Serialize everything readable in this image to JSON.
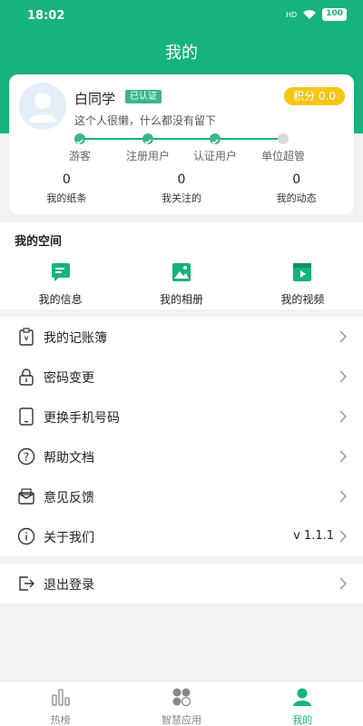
{
  "status_bar": {
    "time": "18:02",
    "signal": "HD",
    "battery": "100"
  },
  "header": {
    "title": "我的"
  },
  "profile": {
    "name": "白同学",
    "verified_badge": "已认证",
    "points": "积分 0.0",
    "signature": "这个人很懒，什么都没有留下",
    "steps": [
      {
        "label": "游客",
        "done": true
      },
      {
        "label": "注册用户",
        "done": true
      },
      {
        "label": "认证用户",
        "done": true
      },
      {
        "label": "单位超管",
        "done": false
      }
    ],
    "stats": [
      {
        "value": "0",
        "label": "我的纸条"
      },
      {
        "value": "0",
        "label": "我关注的"
      },
      {
        "value": "0",
        "label": "我的动态"
      }
    ]
  },
  "space": {
    "title": "我的空间",
    "items": [
      {
        "label": "我的信息",
        "icon": "message-icon"
      },
      {
        "label": "我的相册",
        "icon": "album-icon"
      },
      {
        "label": "我的视频",
        "icon": "video-icon"
      }
    ]
  },
  "menu": [
    {
      "label": "我的记账簿",
      "icon": "ledger-icon",
      "value": ""
    },
    {
      "label": "密码变更",
      "icon": "lock-icon",
      "value": ""
    },
    {
      "label": "更换手机号码",
      "icon": "phone-icon",
      "value": ""
    },
    {
      "label": "帮助文档",
      "icon": "help-icon",
      "value": ""
    },
    {
      "label": "意见反馈",
      "icon": "feedback-icon",
      "value": ""
    },
    {
      "label": "关于我们",
      "icon": "info-icon",
      "value": "v 1.1.1"
    }
  ],
  "logout": {
    "label": "退出登录",
    "icon": "logout-icon"
  },
  "tabbar": [
    {
      "label": "热榜",
      "icon": "chart-icon",
      "active": false
    },
    {
      "label": "智慧应用",
      "icon": "apps-icon",
      "active": false
    },
    {
      "label": "我的",
      "icon": "user-icon",
      "active": true
    }
  ],
  "colors": {
    "brand": "#16b37d",
    "points_badge": "#f5c518",
    "verified_badge": "#3bb68a"
  }
}
